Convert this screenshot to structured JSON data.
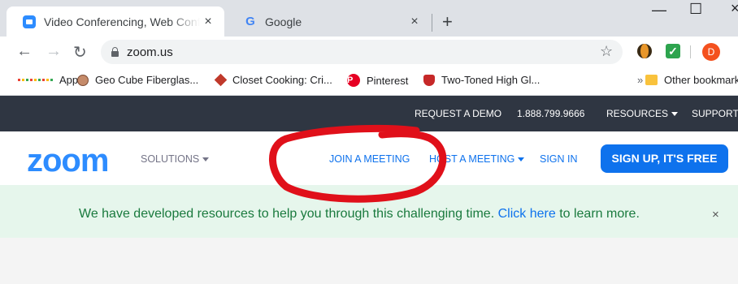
{
  "browser": {
    "tabs": [
      {
        "label": "Video Conferencing, Web Conferencing",
        "active": true,
        "favicon": "zoom-icon"
      },
      {
        "label": "Google",
        "active": false,
        "favicon": "google-icon"
      }
    ],
    "new_tab_label": "+",
    "close_label": "×",
    "window_controls": {
      "minimize": "—",
      "maximize": "☐",
      "close": "×"
    },
    "address": "zoom.us",
    "profile_initial": "D",
    "bookmarks": [
      {
        "label": "Apps",
        "icon": "apps-icon"
      },
      {
        "label": "Geo Cube Fiberglas...",
        "icon": "geo-cube-icon"
      },
      {
        "label": "Closet Cooking: Cri...",
        "icon": "closet-cooking-icon"
      },
      {
        "label": "Pinterest",
        "icon": "pinterest-icon"
      },
      {
        "label": "Two-Toned High Gl...",
        "icon": "shield-icon"
      }
    ],
    "bookmarks_overflow": "»",
    "other_bookmarks": "Other bookmarks"
  },
  "site": {
    "utility_bar": {
      "request_demo": "REQUEST A DEMO",
      "phone": "1.888.799.9666",
      "resources": "RESOURCES",
      "support": "SUPPORT"
    },
    "logo": "zoom",
    "nav": {
      "solutions": "SOLUTIONS",
      "join": "JOIN A MEETING",
      "host": "HOST A MEETING",
      "sign_in": "SIGN IN",
      "sign_up": "SIGN UP, IT'S FREE"
    },
    "banner": {
      "text_before": "We have developed resources to help you through this challenging time.",
      "link": "Click here",
      "text_after": "to learn more.",
      "close": "×"
    }
  },
  "colors": {
    "zoom_blue": "#0e72ed",
    "utility_bar": "#2f3642",
    "banner_bg": "#e6f6ec",
    "banner_text": "#1a7a3e",
    "annotation": "#e0101a"
  }
}
